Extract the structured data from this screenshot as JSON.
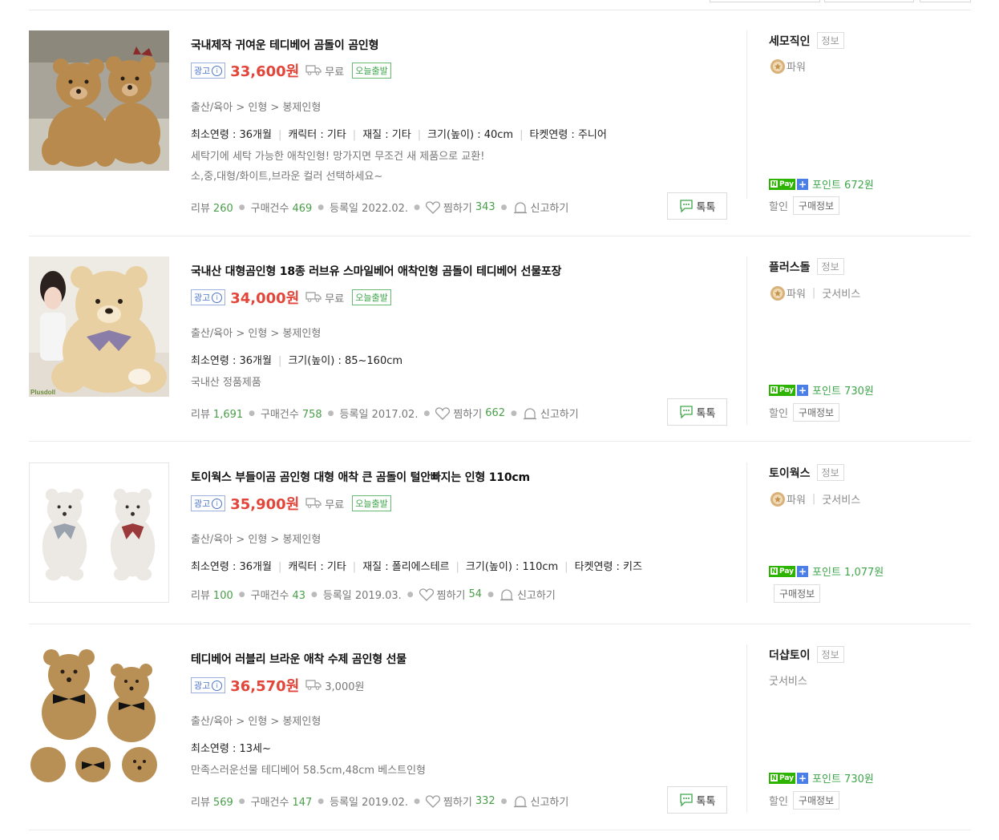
{
  "labels": {
    "ad": "광고",
    "info_icon": "i",
    "talk": "톡톡",
    "info": "정보",
    "discount": "할인",
    "purchase_info": "구매정보",
    "review": "리뷰",
    "purchases": "구매건수",
    "registered": "등록일",
    "wish": "찜하기",
    "report": "신고하기",
    "npay_badge": "Pay",
    "npay_plus": "+"
  },
  "items": [
    {
      "title": "국내제작 귀여운 테디베어 곰돌이 곰인형",
      "price": "33,600원",
      "shipping": "무료",
      "today_ship": "오늘출발",
      "category": "출산/육아 > 인형 > 봉제인형",
      "specs": [
        "최소연령 : 36개월",
        "캐릭터 : 기타",
        "재질 : 기타",
        "크기(높이) : 40cm",
        "타켓연령 : 주니어"
      ],
      "desc": [
        "세탁기에 세탁 가능한 애착인형! 망가지면 무조건 새 제품으로 교환!",
        "소,중,대형/화이트,브라운 컬러 선택하세요~"
      ],
      "reviews": "260",
      "purchases": "469",
      "registered": "2022.02.",
      "wishes": "343",
      "seller": "세모직인",
      "grade": [
        "파워"
      ],
      "points": "포인트 672원"
    },
    {
      "title": "국내산 대형곰인형 18종 러브유 스마일베어 애착인형 곰돌이 테디베어 선물포장",
      "price": "34,000원",
      "shipping": "무료",
      "today_ship": "오늘출발",
      "category": "출산/육아 > 인형 > 봉제인형",
      "specs": [
        "최소연령 : 36개월",
        "크기(높이) : 85~160cm"
      ],
      "desc": [
        "국내산 정품제품"
      ],
      "reviews": "1,691",
      "purchases": "758",
      "registered": "2017.02.",
      "wishes": "662",
      "seller": "플러스돌",
      "grade": [
        "파워",
        "굿서비스"
      ],
      "points": "포인트 730원",
      "thumb_text": "Plusdoll"
    },
    {
      "title": "토이웍스 부들이곰 곰인형 대형 애착 큰 곰돌이 털안빠지는 인형 110cm",
      "price": "35,900원",
      "shipping": "무료",
      "today_ship": "오늘출발",
      "category": "출산/육아 > 인형 > 봉제인형",
      "specs": [
        "최소연령 : 36개월",
        "캐릭터 : 기타",
        "재질 : 폴리에스테르",
        "크기(높이) : 110cm",
        "타켓연령 : 키즈"
      ],
      "desc": [],
      "reviews": "100",
      "purchases": "43",
      "registered": "2019.03.",
      "wishes": "54",
      "seller": "토이웍스",
      "grade": [
        "파워",
        "굿서비스"
      ],
      "points": "포인트 1,077원"
    },
    {
      "title": "테디베어 러블리 브라운 애착 수제 곰인형 선물",
      "price": "36,570원",
      "shipping": "3,000원",
      "today_ship": "",
      "category": "출산/육아 > 인형 > 봉제인형",
      "specs": [
        "최소연령 : 13세~"
      ],
      "desc": [
        "만족스러운선물 테디베어 58.5cm,48cm 베스트인형"
      ],
      "reviews": "569",
      "purchases": "147",
      "registered": "2019.02.",
      "wishes": "332",
      "seller": "더샵토이",
      "grade": [
        "굿서비스"
      ],
      "points": "포인트 730원"
    }
  ],
  "colors": {
    "price": "#e2463b",
    "green": "#3fa64b",
    "ad_blue": "#4a74c9",
    "npay_green": "#2db400"
  }
}
